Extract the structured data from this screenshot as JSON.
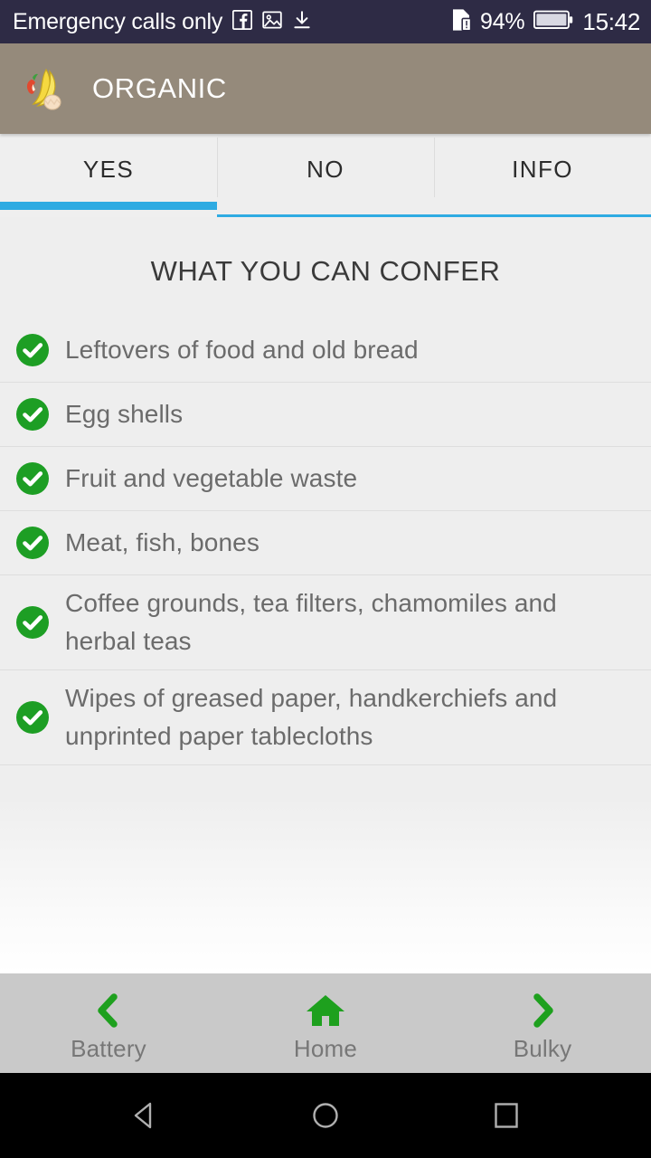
{
  "status_bar": {
    "carrier": "Emergency calls only",
    "icons": [
      "facebook-icon",
      "image-icon",
      "download-icon"
    ],
    "sim_icon": "sim-alert-icon",
    "battery_percent": "94%",
    "battery_icon": "battery-icon",
    "clock": "15:42",
    "background_color": "#2e2b45",
    "text_color": "#ffffff"
  },
  "app_bar": {
    "title": "ORGANIC",
    "logo_icon": "organic-waste-logo",
    "background_color": "#958a7b",
    "title_color": "#ffffff"
  },
  "tabs": {
    "active_index": 0,
    "indicator_color": "#2eabe2",
    "items": [
      {
        "label": "YES"
      },
      {
        "label": "NO"
      },
      {
        "label": "INFO"
      }
    ]
  },
  "main": {
    "section_title": "WHAT YOU CAN CONFER",
    "check_color": "#1d9e24",
    "items": [
      {
        "icon": "check-circle-icon",
        "text": "Leftovers of food and old bread"
      },
      {
        "icon": "check-circle-icon",
        "text": "Egg shells"
      },
      {
        "icon": "check-circle-icon",
        "text": "Fruit and vegetable waste"
      },
      {
        "icon": "check-circle-icon",
        "text": "Meat, fish, bones"
      },
      {
        "icon": "check-circle-icon",
        "text": "Coffee grounds, tea filters, chamomiles and herbal teas"
      },
      {
        "icon": "check-circle-icon",
        "text": "Wipes of greased paper, handkerchiefs and unprinted paper tablecloths"
      }
    ]
  },
  "bottom_nav": {
    "background_color": "#c9c9c9",
    "icon_color": "#1ea01e",
    "label_color": "#777777",
    "items": [
      {
        "icon": "chevron-left-icon",
        "label": "Battery"
      },
      {
        "icon": "home-icon",
        "label": "Home"
      },
      {
        "icon": "chevron-right-icon",
        "label": "Bulky"
      }
    ]
  },
  "android_nav": {
    "background_color": "#000000",
    "items": [
      {
        "icon": "back-triangle-icon"
      },
      {
        "icon": "home-circle-icon"
      },
      {
        "icon": "recents-square-icon"
      }
    ]
  }
}
